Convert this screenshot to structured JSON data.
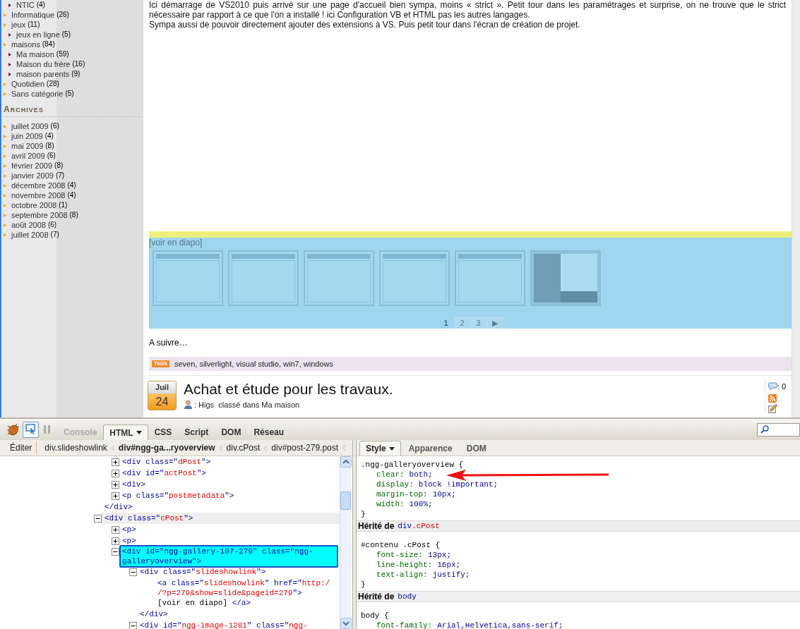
{
  "sidebar": {
    "categories": [
      {
        "children": [
          {
            "label": "NTIC",
            "count": "(4)"
          }
        ]
      },
      {
        "label": "Informatique",
        "count": "(26)"
      },
      {
        "label": "jeux",
        "count": "(11)",
        "children": [
          {
            "label": "jeux en ligne",
            "count": "(5)"
          }
        ]
      },
      {
        "label": "maisons",
        "count": "(84)",
        "children": [
          {
            "label": "Ma maison",
            "count": "(59)"
          },
          {
            "label": "Maison du frère",
            "count": "(16)"
          },
          {
            "label": "maison parents",
            "count": "(9)"
          }
        ]
      },
      {
        "label": "Quotidien",
        "count": "(28)"
      },
      {
        "label": "Sans catégorie",
        "count": "(5)"
      }
    ],
    "archives_title": "ARCHIVES",
    "archives": [
      {
        "label": "juillet 2009",
        "count": "(6)"
      },
      {
        "label": "juin 2009",
        "count": "(4)"
      },
      {
        "label": "mai 2009",
        "count": "(8)"
      },
      {
        "label": "avril 2009",
        "count": "(6)"
      },
      {
        "label": "février 2009",
        "count": "(8)"
      },
      {
        "label": "janvier 2009",
        "count": "(7)"
      },
      {
        "label": "décembre 2008",
        "count": "(4)"
      },
      {
        "label": "novembre 2008",
        "count": "(4)"
      },
      {
        "label": "octobre 2008",
        "count": "(1)"
      },
      {
        "label": "septembre 2008",
        "count": "(8)"
      },
      {
        "label": "août 2008",
        "count": "(6)"
      },
      {
        "label": "juillet 2008",
        "count": "(7)"
      }
    ]
  },
  "article": {
    "paragraphs": [
      "Ici démarrage de VS2010 puis arrivé sur une page d'accueil bien sympa, moins « strict ». Petit tour dans les paramétrages et surprise, on ne trouve que le strict nécessaire par rapport à ce que l'on a installé ! ici Configuration VB et HTML pas les autres langages.",
      "Sympa aussi de pouvoir directement ajouter des extensions à VS. Puis petit tour dans l'écran de création de projet."
    ],
    "gallery": {
      "highlighted": true,
      "slideshow_link": "[voir en diapo]",
      "thumbnails": [
        {
          "kind": "window"
        },
        {
          "kind": "window"
        },
        {
          "kind": "window"
        },
        {
          "kind": "window"
        },
        {
          "kind": "window"
        },
        {
          "kind": "panel"
        }
      ],
      "pages": [
        {
          "label": "1",
          "selected": true
        },
        {
          "label": "2",
          "selected": false
        },
        {
          "label": "3",
          "selected": false
        },
        {
          "label": "▶",
          "selected": false
        }
      ]
    },
    "after_text": "A suivre…",
    "tags_label": "TAGS",
    "tags": "seven, silverlight, visual studio, win7, windows"
  },
  "next_post": {
    "month": "Juil",
    "day": "24",
    "title": "Achat et étude pour les travaux.",
    "meta": ": Higs  classé dans Ma maison",
    "comments": ": 0"
  },
  "firebug": {
    "inspect_pressed": true,
    "tabs": [
      {
        "label": "Console",
        "selected": false,
        "disabled": true,
        "dropdown": false
      },
      {
        "label": "HTML",
        "selected": true,
        "disabled": false,
        "dropdown": true
      },
      {
        "label": "CSS",
        "selected": false,
        "disabled": false,
        "dropdown": false
      },
      {
        "label": "Script",
        "selected": false,
        "disabled": false,
        "dropdown": false
      },
      {
        "label": "DOM",
        "selected": false,
        "disabled": false,
        "dropdown": false
      },
      {
        "label": "Réseau",
        "selected": false,
        "disabled": false,
        "dropdown": false
      }
    ],
    "edit_button": "Éditer",
    "breadcrumbs": [
      {
        "label": "div.slideshowlink",
        "selected": false
      },
      {
        "label": "div#ngg-ga...ryoverview",
        "selected": true
      },
      {
        "label": "div.cPost",
        "selected": false
      },
      {
        "label": "div#post-279.post",
        "selected": false
      }
    ],
    "tree": [
      {
        "kind": "partial",
        "children": [
          {
            "kind": "element",
            "expanded": false,
            "selected": false,
            "hovered": false,
            "open": [
              {
                "t": "<div class=\"",
                "kind": "markup"
              },
              {
                "t": "dPost",
                "kind": "value"
              },
              {
                "t": "\">",
                "kind": "markup"
              }
            ]
          },
          {
            "kind": "element",
            "expanded": false,
            "selected": false,
            "hovered": false,
            "open": [
              {
                "t": "<div id=\"",
                "kind": "markup"
              },
              {
                "t": "actPost",
                "kind": "value"
              },
              {
                "t": "\">",
                "kind": "markup"
              }
            ]
          },
          {
            "kind": "element",
            "expanded": false,
            "selected": false,
            "hovered": false,
            "open": [
              {
                "t": "<div>",
                "kind": "markup"
              }
            ]
          },
          {
            "kind": "element",
            "expanded": false,
            "selected": false,
            "hovered": false,
            "open": [
              {
                "t": "<p class=\"",
                "kind": "markup"
              },
              {
                "t": "postmetadata",
                "kind": "value"
              },
              {
                "t": "\">",
                "kind": "markup"
              }
            ]
          }
        ],
        "close": [
          {
            "t": "</div>",
            "kind": "markup"
          }
        ]
      },
      {
        "kind": "element",
        "expanded": true,
        "selected": false,
        "hovered": true,
        "open": [
          {
            "t": "<div class=\"",
            "kind": "markup"
          },
          {
            "t": "cPost",
            "kind": "value"
          },
          {
            "t": "\">",
            "kind": "markup"
          }
        ],
        "children": [
          {
            "kind": "element",
            "expanded": false,
            "selected": false,
            "hovered": false,
            "open": [
              {
                "t": "<p>",
                "kind": "markup"
              }
            ]
          },
          {
            "kind": "element",
            "expanded": false,
            "selected": false,
            "hovered": false,
            "open": [
              {
                "t": "<p>",
                "kind": "markup"
              }
            ]
          },
          {
            "kind": "element",
            "expanded": true,
            "selected": true,
            "hovered": false,
            "open": [
              {
                "t": "<div id=\"ngg-gallery-107-279\" class=\"ngg-galleryoverview\">",
                "kind": "markup"
              }
            ],
            "children": [
              {
                "kind": "element",
                "expanded": true,
                "selected": false,
                "hovered": false,
                "open": [
                  {
                    "t": "<div class=\"",
                    "kind": "markup"
                  },
                  {
                    "t": "slideshowlink",
                    "kind": "value"
                  },
                  {
                    "t": "\">",
                    "kind": "markup"
                  }
                ],
                "children": [
                  {
                    "kind": "text",
                    "lines": [
                      [
                        {
                          "t": "<a class=\"",
                          "kind": "markup"
                        },
                        {
                          "t": "slideshowlink",
                          "kind": "value"
                        },
                        {
                          "t": "\" href=\"",
                          "kind": "markup"
                        },
                        {
                          "t": "http:/",
                          "kind": "value"
                        }
                      ],
                      [
                        {
                          "t": "/?p=279&show=slide&pageid=279",
                          "kind": "value"
                        },
                        {
                          "t": "\">",
                          "kind": "markup"
                        }
                      ],
                      [
                        {
                          "t": "[voir en diapo] ",
                          "kind": "content"
                        },
                        {
                          "t": "</a>",
                          "kind": "markup"
                        }
                      ]
                    ]
                  }
                ],
                "close": [
                  {
                    "t": "</div>",
                    "kind": "markup"
                  }
                ]
              },
              {
                "kind": "element",
                "expanded": true,
                "selected": false,
                "hovered": false,
                "open": [
                  {
                    "t": "<div id=\"",
                    "kind": "markup"
                  },
                  {
                    "t": "ngg-image-1281",
                    "kind": "value"
                  },
                  {
                    "t": "\" class=\"",
                    "kind": "markup"
                  },
                  {
                    "t": "ngg-",
                    "kind": "value"
                  }
                ]
              }
            ]
          }
        ]
      }
    ],
    "style_tabs": [
      {
        "label": "Style",
        "selected": true,
        "dropdown": true
      },
      {
        "label": "Apparence",
        "selected": false,
        "dropdown": false
      },
      {
        "label": "DOM",
        "selected": false,
        "dropdown": false
      }
    ],
    "styles": [
      {
        "kind": "rule",
        "selector": ".ngg-galleryoverview {",
        "properties": [
          {
            "name": "clear:",
            "value": "both;"
          },
          {
            "name": "display:",
            "value": "block !important;"
          },
          {
            "name": "margin-top:",
            "value": "10px;"
          },
          {
            "name": "width:",
            "value": "100%;"
          }
        ],
        "close": "}"
      },
      {
        "kind": "inherited",
        "label": "Hérité de",
        "tag": "div",
        "cls": ".cPost"
      },
      {
        "kind": "rule",
        "selector": "#contenu .cPost {",
        "properties": [
          {
            "name": "font-size:",
            "value": "13px;"
          },
          {
            "name": "line-height:",
            "value": "16px;"
          },
          {
            "name": "text-align:",
            "value": "justify;"
          }
        ],
        "close": "}"
      },
      {
        "kind": "inherited",
        "label": "Hérité de",
        "tag": "body"
      },
      {
        "kind": "rule",
        "selector": "body {",
        "properties": [
          {
            "name": "font-family:",
            "value": "Arial,Helvetica,sans-serif;"
          }
        ]
      }
    ],
    "arrow_annotation": true
  }
}
